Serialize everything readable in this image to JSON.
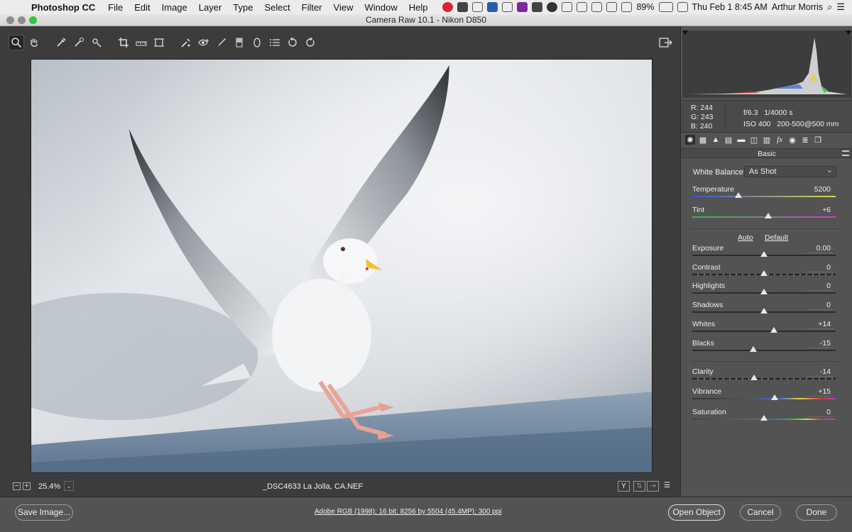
{
  "menubar": {
    "app_name": "Photoshop CC",
    "menus": [
      "File",
      "Edit",
      "Image",
      "Layer",
      "Type",
      "Select",
      "Filter",
      "View",
      "Window",
      "Help"
    ],
    "battery": "89%",
    "datetime": "Thu Feb 1  8:45 AM",
    "user": "Arthur Morris"
  },
  "window": {
    "title": "Camera Raw 10.1  -  Nikon D850"
  },
  "toolbar": {
    "tools": [
      "zoom-tool",
      "hand-tool",
      "white-balance-tool",
      "color-sampler-tool",
      "targeted-adjustment-tool",
      "crop-tool",
      "straighten-tool",
      "transform-tool",
      "spot-removal-tool",
      "red-eye-tool",
      "adjustment-brush",
      "graduated-filter",
      "radial-filter",
      "preferences-list",
      "rotate-left",
      "rotate-right"
    ]
  },
  "statusbar": {
    "zoom": "25.4%",
    "filename": "_DSC4633  La Jolla, CA.NEF"
  },
  "panel": {
    "rgb": {
      "r": "R:  244",
      "g": "G:  243",
      "b": "B:  240"
    },
    "camera": {
      "aperture": "f/6.3",
      "shutter": "1/4000 s",
      "iso": "ISO 400",
      "lens": "200-500@500 mm"
    },
    "section": "Basic",
    "white_balance": {
      "label": "White Balance:",
      "value": "As Shot"
    },
    "auto_label": "Auto",
    "default_label": "Default",
    "sliders": [
      {
        "label": "Temperature",
        "value": "5200",
        "pos": 0.32
      },
      {
        "label": "Tint",
        "value": "+6",
        "pos": 0.53
      },
      {
        "label": "Exposure",
        "value": "0.00",
        "pos": 0.5
      },
      {
        "label": "Contrast",
        "value": "0",
        "pos": 0.5
      },
      {
        "label": "Highlights",
        "value": "0",
        "pos": 0.5
      },
      {
        "label": "Shadows",
        "value": "0",
        "pos": 0.5
      },
      {
        "label": "Whites",
        "value": "+14",
        "pos": 0.57
      },
      {
        "label": "Blacks",
        "value": "-15",
        "pos": 0.425
      },
      {
        "label": "Clarity",
        "value": "-14",
        "pos": 0.43
      },
      {
        "label": "Vibrance",
        "value": "+15",
        "pos": 0.575
      },
      {
        "label": "Saturation",
        "value": "0",
        "pos": 0.5
      }
    ]
  },
  "footer": {
    "save_label": "Save Image...",
    "workflow": "Adobe RGB (1998); 16 bit; 8256 by 5504 (45.4MP); 300 ppi",
    "open_label": "Open Object",
    "cancel_label": "Cancel",
    "done_label": "Done"
  }
}
